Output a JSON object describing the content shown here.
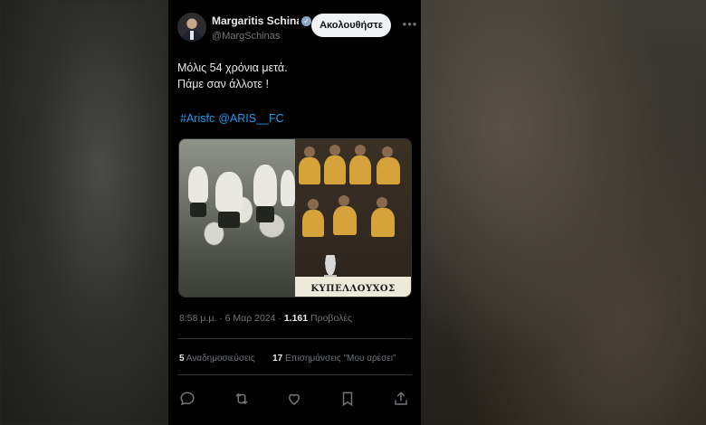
{
  "tweet": {
    "author": {
      "display_name": "Margaritis Schinas",
      "handle": "@MargSchinas",
      "verified": true
    },
    "follow_label": "Ακολουθήστε",
    "text_line1": "Μόλις 54 χρόνια μετά.",
    "text_line2": "Πάμε σαν άλλοτε !",
    "hashtag": "#Arisfc",
    "mention": "@ARIS__FC",
    "image_caption": "ΚΥΠΕΛΛΟΥΧΟΣ",
    "time": "8:58 μ.μ.",
    "date": "6 Μαρ 2024",
    "views_count": "1.161",
    "views_label": "Προβολές",
    "reposts_count": "5",
    "reposts_label": "Αναδημοσιεύσεις",
    "quotes_count": "17",
    "quotes_label": "Επισημάνσεις \"Μου αρέσει\""
  },
  "icons": {
    "reply": "reply-icon",
    "retweet": "retweet-icon",
    "like": "heart-icon",
    "bookmark": "bookmark-icon",
    "share": "share-icon"
  },
  "colors": {
    "background": "#000000",
    "text": "#e7e9ea",
    "muted": "#71767b",
    "link": "#1d9bf0"
  }
}
